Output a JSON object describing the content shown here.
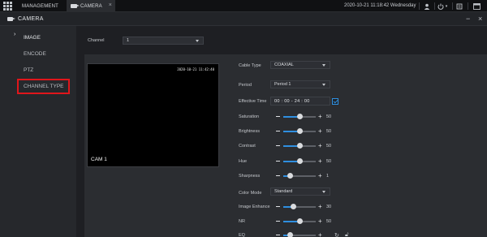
{
  "topbar": {
    "tabs": [
      {
        "label": "MANAGEMENT"
      },
      {
        "label": "CAMERA"
      }
    ],
    "close_glyph": "×",
    "datetime": "2020-10-21 11:18:42 Wednesday",
    "icons": [
      "user-icon",
      "power-icon",
      "sync-icon",
      "window-icon"
    ]
  },
  "window": {
    "title": "CAMERA",
    "minimize_glyph": "−",
    "close_glyph": "×"
  },
  "sidebar": {
    "items": [
      {
        "label": "IMAGE",
        "active": true
      },
      {
        "label": "ENCODE"
      },
      {
        "label": "PTZ"
      },
      {
        "label": "CHANNEL TYPE",
        "highlighted": true
      }
    ],
    "arrow_glyph": "›"
  },
  "main": {
    "channel_label": "Channel",
    "channel_value": "1",
    "video": {
      "osd_time": "2020-10-21 11:42:40",
      "osd_cam": "CAM 1"
    },
    "cable_type_label": "Cable Type",
    "cable_type_value": "COAXIAL",
    "period_label": "Period",
    "period_value": "Period 1",
    "effective_time_label": "Effective Time",
    "effective_time_value": "00 : 00 - 24 : 00",
    "sliders": [
      {
        "label": "Saturation",
        "value": "50",
        "fraction": 0.5
      },
      {
        "label": "Brightness",
        "value": "50",
        "fraction": 0.5
      },
      {
        "label": "Contrast",
        "value": "50",
        "fraction": 0.5
      },
      {
        "label": "Hue",
        "value": "50",
        "fraction": 0.5
      },
      {
        "label": "Sharpness",
        "value": "1",
        "fraction": 0.2
      }
    ],
    "color_mode_label": "Color Mode",
    "color_mode_value": "Standard",
    "sliders2": [
      {
        "label": "Image Enhance",
        "value": "30",
        "fraction": 0.3
      },
      {
        "label": "NR",
        "value": "50",
        "fraction": 0.5
      },
      {
        "label": "EQ",
        "value": "",
        "fraction": 0.2
      }
    ]
  },
  "colors": {
    "accent": "#2f8fe0",
    "highlight": "#e0161b"
  }
}
